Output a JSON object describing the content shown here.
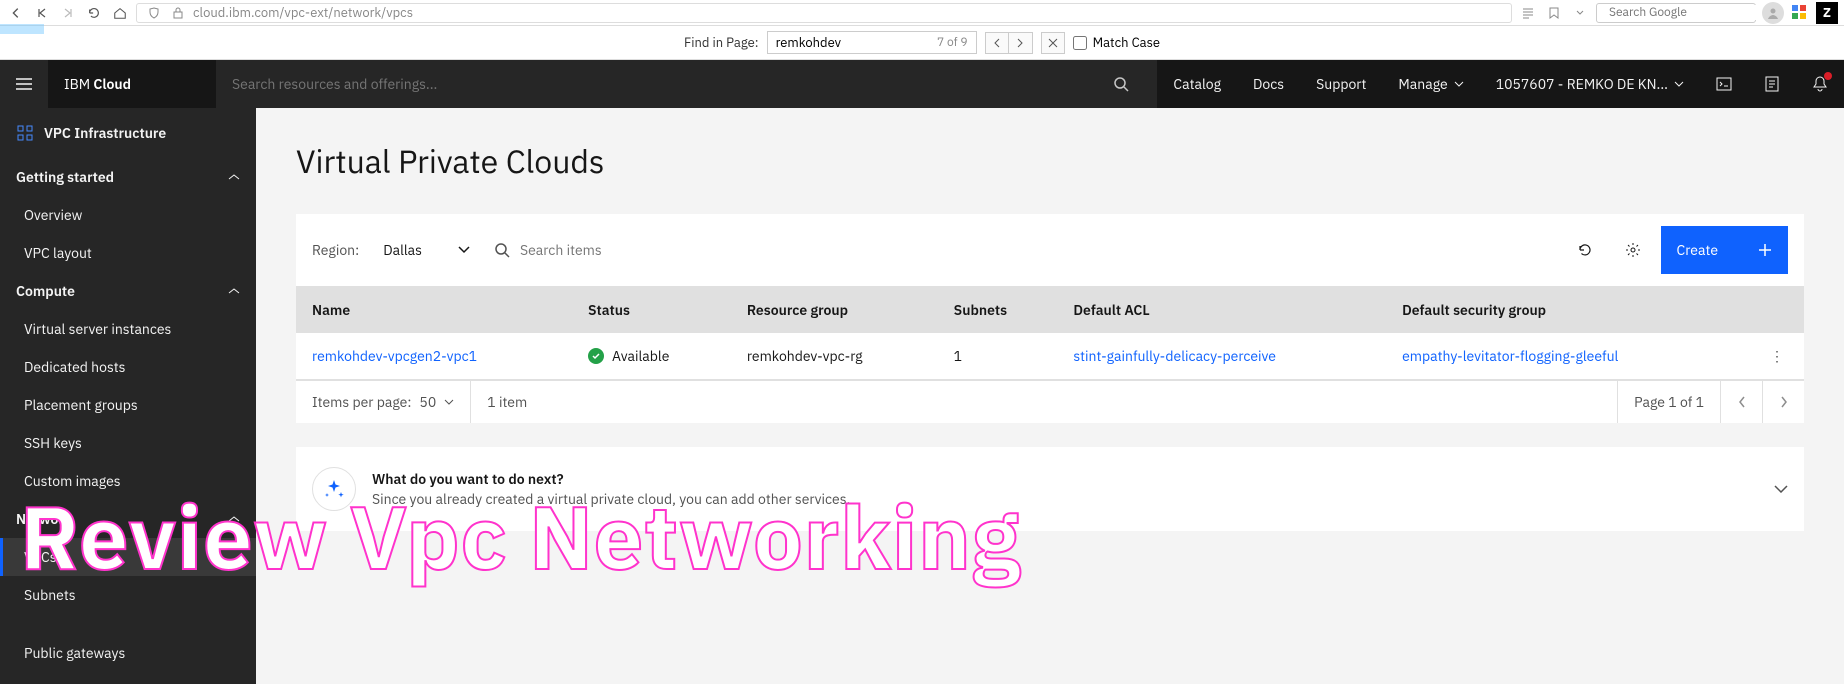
{
  "browser": {
    "url": "cloud.ibm.com/vpc-ext/network/vpcs",
    "search_placeholder": "Search Google",
    "z": "Z"
  },
  "findbar": {
    "label": "Find in Page:",
    "value": "remkohdev",
    "count": "7 of 9",
    "match_case": "Match Case"
  },
  "header": {
    "brand_light": "IBM ",
    "brand_bold": "Cloud",
    "search_placeholder": "Search resources and offerings...",
    "links": {
      "catalog": "Catalog",
      "docs": "Docs",
      "support": "Support",
      "manage": "Manage",
      "account": "1057607 - REMKO DE KN..."
    }
  },
  "sidebar": {
    "title": "VPC Infrastructure",
    "sections": [
      {
        "label": "Getting started",
        "items": [
          "Overview",
          "VPC layout"
        ]
      },
      {
        "label": "Compute",
        "items": [
          "Virtual server instances",
          "Dedicated hosts",
          "Placement groups",
          "SSH keys",
          "Custom images"
        ]
      },
      {
        "label": "Network",
        "items": [
          "VPCs",
          "Subnets",
          "Public gateways"
        ]
      }
    ],
    "active_item": "VPCs",
    "hidden_item": ""
  },
  "page": {
    "title": "Virtual Private Clouds",
    "region_label": "Region:",
    "region_value": "Dallas",
    "search_placeholder": "Search items",
    "create_label": "Create"
  },
  "table": {
    "headers": [
      "Name",
      "Status",
      "Resource group",
      "Subnets",
      "Default ACL",
      "Default security group"
    ],
    "row": {
      "name": "remkohdev-vpcgen2-vpc1",
      "status": "Available",
      "rg": "remkohdev-vpc-rg",
      "subnets": "1",
      "acl": "stint-gainfully-delicacy-perceive",
      "sg": "empathy-levitator-flogging-gleeful"
    }
  },
  "pagination": {
    "items_per_page_label": "Items per page:",
    "items_per_page_value": "50",
    "item_count": "1 item",
    "page_of": "Page 1 of 1"
  },
  "next": {
    "title": "What do you want to do next?",
    "desc": "Since you already created a virtual private cloud, you can add other services."
  },
  "overlay": "Review Vpc Networking"
}
